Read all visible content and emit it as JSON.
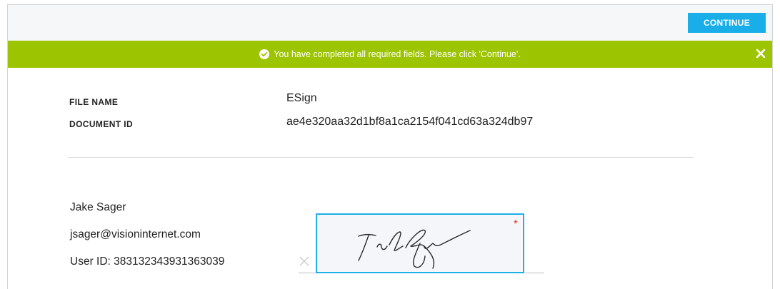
{
  "topbar": {
    "continue_label": "CONTINUE"
  },
  "banner": {
    "message": "You have completed all required fields. Please click 'Continue'."
  },
  "document": {
    "file_name_label": "FILE NAME",
    "file_name_value": "ESign",
    "document_id_label": "DOCUMENT ID",
    "document_id_value": "ae4e320aa32d1bf8a1ca2154f041cd63a324db97"
  },
  "signer": {
    "name": "Jake Sager",
    "email": "jsager@visioninternet.com",
    "user_id": "User ID: 383132343931363039"
  },
  "signature": {
    "required_marker": "*"
  },
  "colors": {
    "accent": "#19aee8",
    "banner": "#9dc400",
    "required": "#e0302c"
  }
}
